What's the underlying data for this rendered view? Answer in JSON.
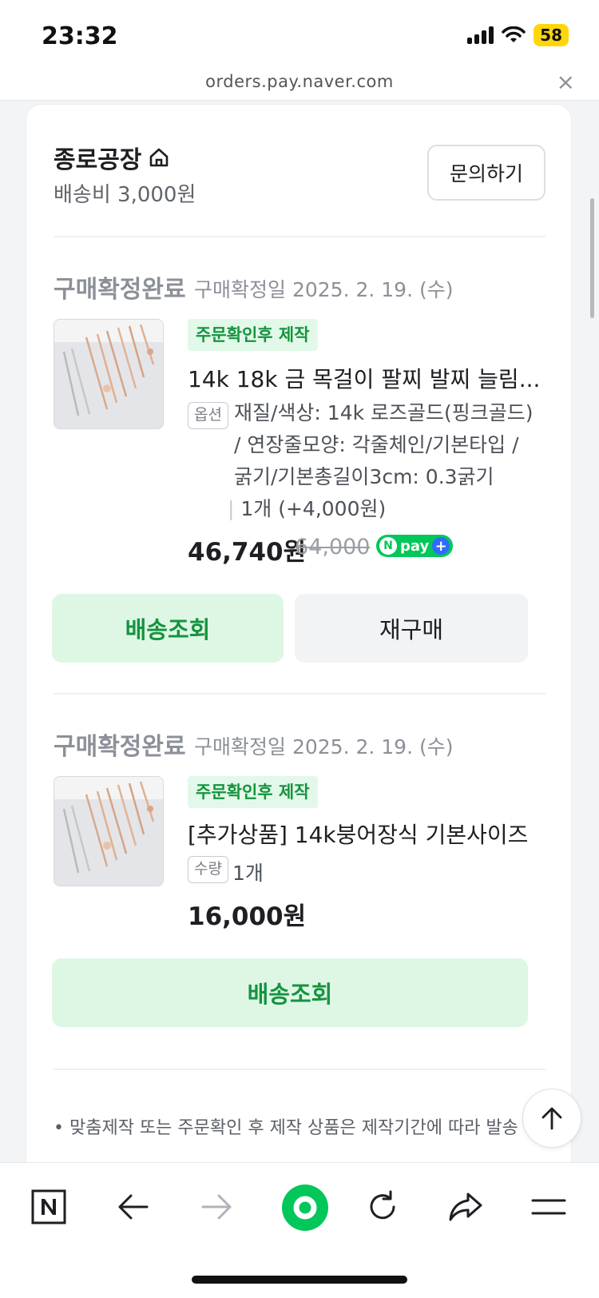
{
  "status_bar": {
    "time": "23:32",
    "battery": "58"
  },
  "browser": {
    "url": "orders.pay.naver.com",
    "close": "×"
  },
  "store": {
    "name": "종로공장",
    "shipping_fee": "배송비 3,000원",
    "inquiry_button": "문의하기"
  },
  "orders": [
    {
      "status": "구매확정완료",
      "confirm_date": "구매확정일 2025. 2. 19. (수)",
      "tag": "주문확인후 제작",
      "title": "14k 18k 금 목걸이 팔찌 발찌 늘림...",
      "badge": "옵션",
      "option_line1": "재질/색상: 14k 로즈골드(핑크골드)",
      "option_line2": "/ 연장줄모양: 각줄체인/기본타입 /",
      "option_line3": "굵기/기본총길이3cm: 0.3굵기",
      "quantity": "1개 (+4,000원)",
      "price": "46,740원",
      "original_price": "64,000",
      "npay_label": "pay",
      "track_button": "배송조회",
      "rebuy_button": "재구매"
    },
    {
      "status": "구매확정완료",
      "confirm_date": "구매확정일 2025. 2. 19. (수)",
      "tag": "주문확인후 제작",
      "title": "[추가상품] 14k붕어장식 기본사이즈",
      "badge": "수량",
      "quantity": "1개",
      "price": "16,000원",
      "track_button": "배송조회"
    }
  ],
  "notice": "• 맞춤제작 또는 주문확인 후 제작 상품은 제작기간에 따라 발송",
  "colors": {
    "accent_green": "#15933f",
    "green_button_bg": "#def7e5",
    "naver_green": "#03c75a"
  },
  "bottom_nav": [
    "naver-logo-icon",
    "back-arrow-icon",
    "forward-arrow-icon",
    "green-circle-home-icon",
    "refresh-icon",
    "share-icon",
    "menu-icon"
  ]
}
